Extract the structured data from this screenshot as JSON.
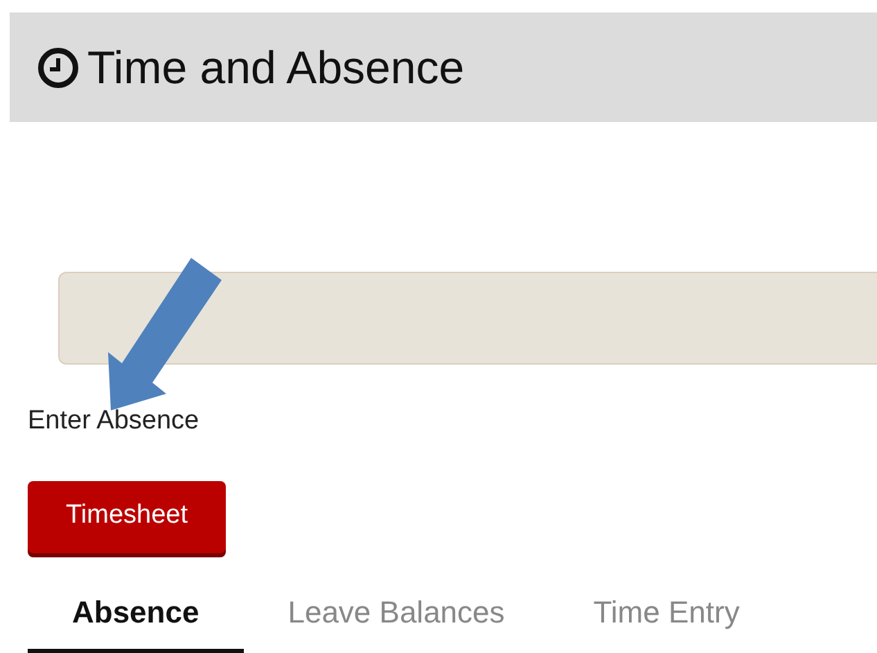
{
  "header": {
    "title": "Time and Absence"
  },
  "link": "Enter Absence",
  "button": "Timesheet",
  "tabs": [
    {
      "label": "Absence",
      "selected": true
    },
    {
      "label": "Leave Balances",
      "selected": false
    },
    {
      "label": "Time Entry",
      "selected": false
    }
  ]
}
